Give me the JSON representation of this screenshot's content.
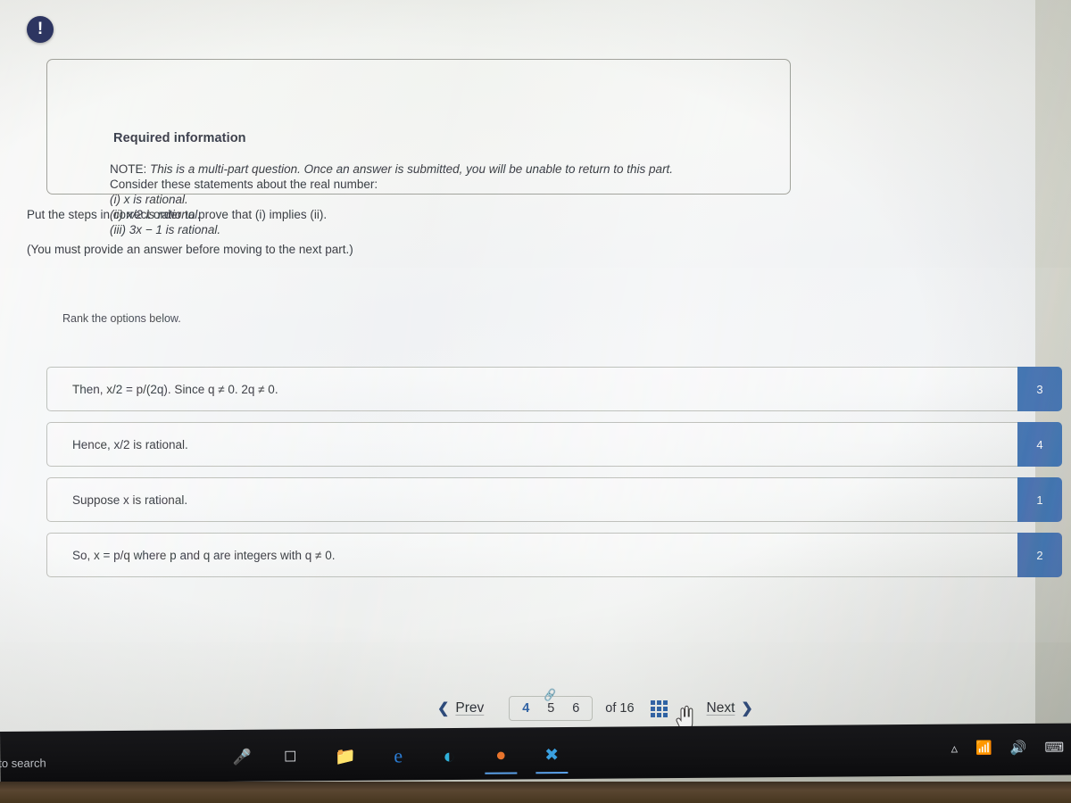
{
  "required_info": {
    "badge_icon": "exclamation-icon",
    "title": "Required information",
    "note_label": "NOTE:",
    "note_italic": "This is a multi-part question. Once an answer is submitted, you will be unable to return to this part.",
    "consider_line": "Consider these statements about the real number:",
    "statements": [
      "(i) x is rational.",
      "(ii) x/2 is rational.",
      "(iii) 3x − 1 is rational."
    ]
  },
  "prompt": {
    "line1": "Put the steps in correct order to prove that (i) implies (ii).",
    "line2": "(You must provide an answer before moving to the next part.)",
    "rank_label": "Rank the options below."
  },
  "options": [
    {
      "text": "Then, x/2 = p/(2q). Since q ≠ 0. 2q ≠ 0.",
      "rank": "3"
    },
    {
      "text": "Hence, x/2 is rational.",
      "rank": "4"
    },
    {
      "text": "Suppose x is rational.",
      "rank": "1"
    },
    {
      "text": "So, x = p/q where p and q are integers with q ≠ 0.",
      "rank": "2"
    }
  ],
  "navigation": {
    "prev_label": "Prev",
    "prev_icon": "chevron-left-icon",
    "pages": [
      "4",
      "5",
      "6"
    ],
    "current_page": "4",
    "link_icon": "link-icon",
    "of_label": "of 16",
    "grid_icon": "grid-view-icon",
    "next_label": "Next",
    "next_icon": "chevron-right-icon",
    "cursor_icon": "hand-pointer-cursor"
  },
  "taskbar": {
    "search_text": "to search",
    "icons": [
      {
        "name": "microphone-icon",
        "glyph": "🎤"
      },
      {
        "name": "task-view-icon",
        "glyph": "❐"
      },
      {
        "name": "file-explorer-icon",
        "glyph": "📁"
      },
      {
        "name": "edge-legacy-icon",
        "glyph": "e"
      },
      {
        "name": "microsoft-edge-icon",
        "glyph": "◔"
      },
      {
        "name": "firefox-icon",
        "glyph": "●"
      },
      {
        "name": "vscode-icon",
        "glyph": "✖"
      }
    ],
    "tray": [
      {
        "name": "show-hidden-icons-chevron",
        "glyph": "ⱏ"
      },
      {
        "name": "wifi-icon",
        "glyph": "📶"
      },
      {
        "name": "volume-icon",
        "glyph": "🔊"
      },
      {
        "name": "keyboard-icon",
        "glyph": "⌨"
      }
    ]
  },
  "colors": {
    "badge_navy": "#2d3561",
    "rank_blue": "#2c63ab",
    "link_blue": "#2159a5",
    "page_bg": "#eef0ec"
  }
}
